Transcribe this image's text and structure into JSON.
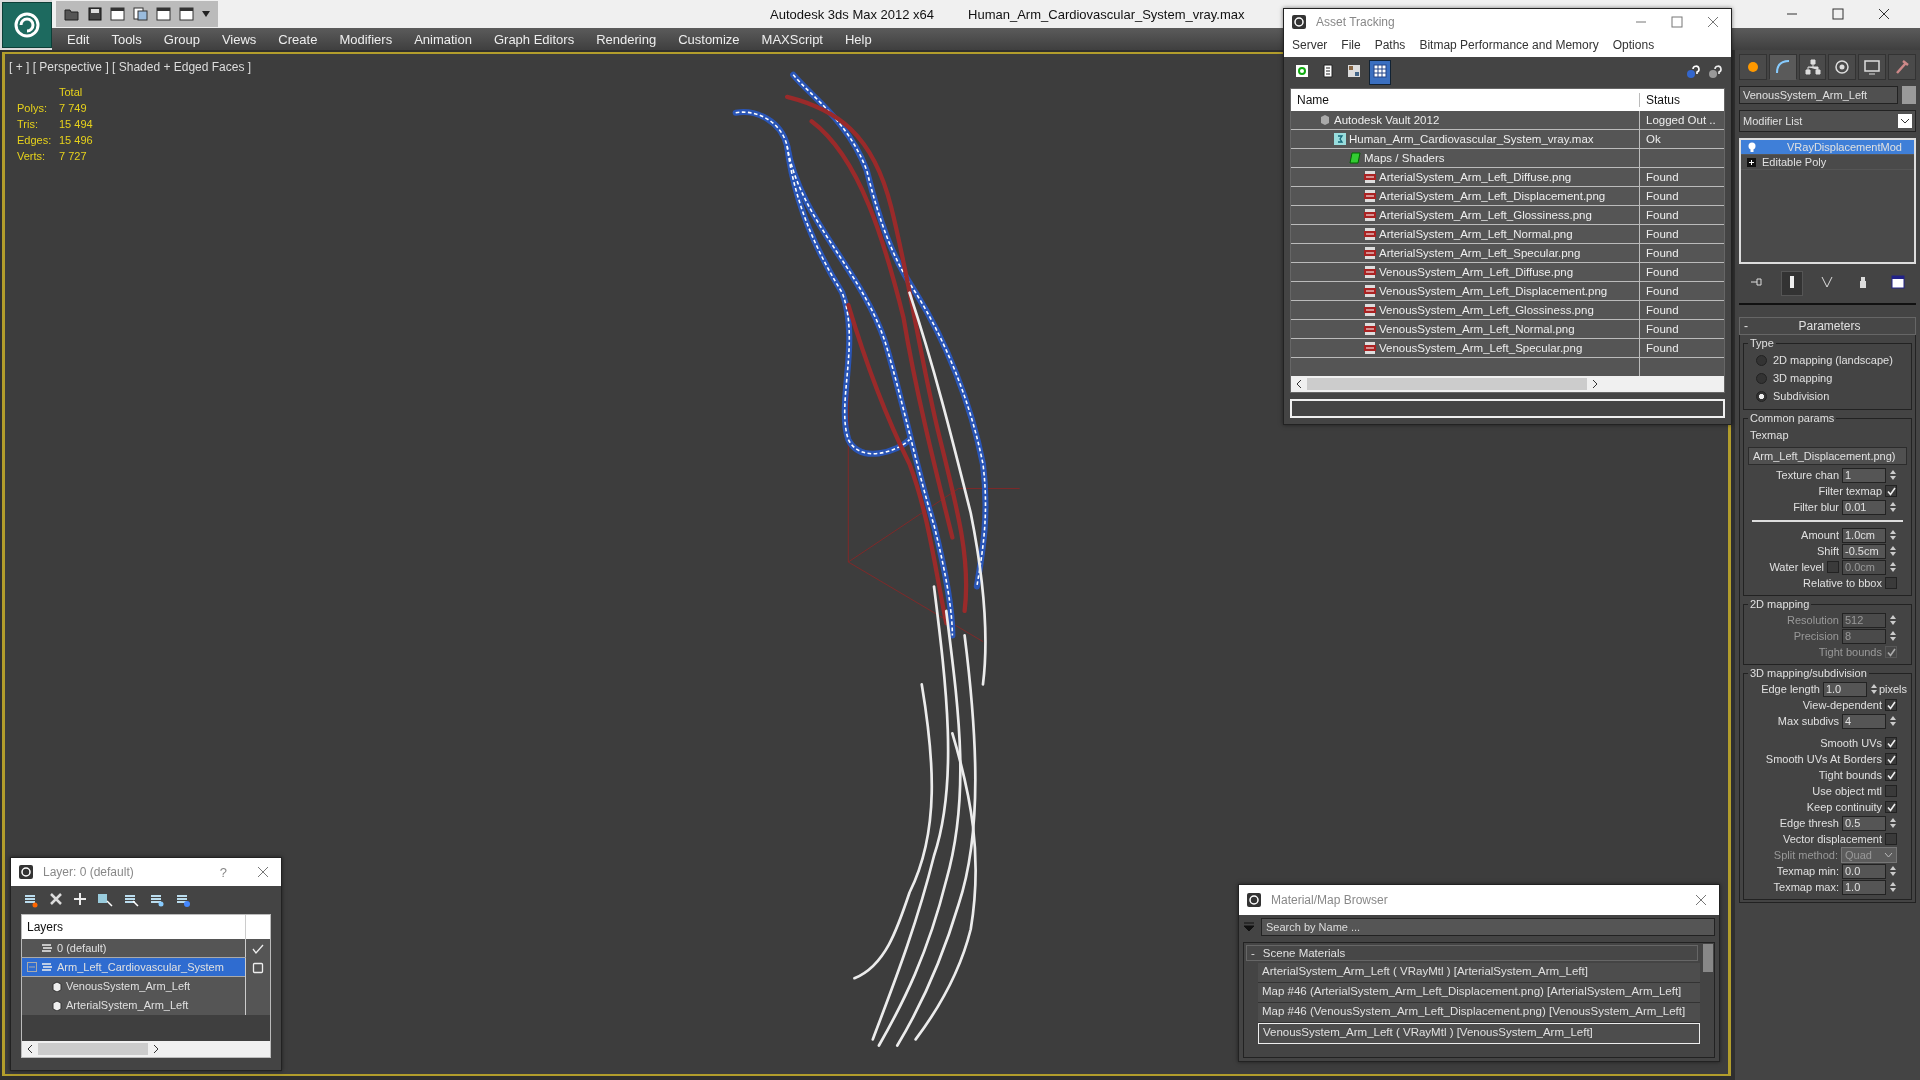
{
  "window": {
    "app_title": "Autodesk 3ds Max  2012 x64",
    "file_title": "Human_Arm_Cardiovascular_System_vray.max"
  },
  "menu": [
    "Edit",
    "Tools",
    "Group",
    "Views",
    "Create",
    "Modifiers",
    "Animation",
    "Graph Editors",
    "Rendering",
    "Customize",
    "MAXScript",
    "Help"
  ],
  "viewport": {
    "label": "[ + ] [ Perspective ] [ Shaded + Edged Faces ]",
    "stats_header": "Total",
    "stats": [
      {
        "label": "Polys:",
        "value": "7 749"
      },
      {
        "label": "Tris:",
        "value": "15 494"
      },
      {
        "label": "Edges:",
        "value": "15 496"
      },
      {
        "label": "Verts:",
        "value": "7 727"
      }
    ]
  },
  "asset_tracking": {
    "title": "Asset Tracking",
    "menu": [
      "Server",
      "File",
      "Paths",
      "Bitmap Performance and Memory",
      "Options"
    ],
    "toolbar": [
      {
        "kind": "refresh",
        "selected": false
      },
      {
        "kind": "list",
        "selected": false
      },
      {
        "kind": "thumbnails",
        "selected": false
      },
      {
        "kind": "table",
        "selected": true
      }
    ],
    "columns": [
      "Name",
      "Status"
    ],
    "tree": [
      {
        "kind": "vault",
        "name": "Autodesk Vault 2012",
        "status": "Logged Out ..",
        "children": [
          {
            "kind": "scene",
            "name": "Human_Arm_Cardiovascular_System_vray.max",
            "status": "Ok",
            "children": [
              {
                "kind": "folder",
                "name": "Maps / Shaders",
                "children": [
                  {
                    "kind": "png",
                    "name": "ArterialSystem_Arm_Left_Diffuse.png",
                    "status": "Found"
                  },
                  {
                    "kind": "png",
                    "name": "ArterialSystem_Arm_Left_Displacement.png",
                    "status": "Found"
                  },
                  {
                    "kind": "png",
                    "name": "ArterialSystem_Arm_Left_Glossiness.png",
                    "status": "Found"
                  },
                  {
                    "kind": "png",
                    "name": "ArterialSystem_Arm_Left_Normal.png",
                    "status": "Found"
                  },
                  {
                    "kind": "png",
                    "name": "ArterialSystem_Arm_Left_Specular.png",
                    "status": "Found"
                  },
                  {
                    "kind": "png",
                    "name": "VenousSystem_Arm_Left_Diffuse.png",
                    "status": "Found"
                  },
                  {
                    "kind": "png",
                    "name": "VenousSystem_Arm_Left_Displacement.png",
                    "status": "Found"
                  },
                  {
                    "kind": "png",
                    "name": "VenousSystem_Arm_Left_Glossiness.png",
                    "status": "Found"
                  },
                  {
                    "kind": "png",
                    "name": "VenousSystem_Arm_Left_Normal.png",
                    "status": "Found"
                  },
                  {
                    "kind": "png",
                    "name": "VenousSystem_Arm_Left_Specular.png",
                    "status": "Found"
                  }
                ]
              }
            ]
          }
        ]
      }
    ]
  },
  "command_panel": {
    "tabs": [
      {
        "kind": "create",
        "selected": false
      },
      {
        "kind": "modify",
        "selected": true
      },
      {
        "kind": "hierarchy",
        "selected": false
      },
      {
        "kind": "motion",
        "selected": false
      },
      {
        "kind": "display",
        "selected": false
      },
      {
        "kind": "utilities",
        "selected": false
      }
    ],
    "object_name": "VenousSystem_Arm_Left",
    "modifier_list": "Modifier List",
    "stack": [
      {
        "kind": "modifier",
        "name": "VRayDisplacementMod",
        "selected": true
      },
      {
        "kind": "base",
        "name": "Editable Poly",
        "selected": false
      }
    ],
    "stack_tools": [
      {
        "kind": "pin",
        "selected": false
      },
      {
        "kind": "end_result",
        "selected": true
      },
      {
        "kind": "unique",
        "selected": false
      },
      {
        "kind": "remove",
        "selected": false
      },
      {
        "kind": "configure",
        "selected": false
      }
    ],
    "rollout": {
      "collapse": "-",
      "title": "Parameters",
      "groups": [
        {
          "title": "Type",
          "rows": [
            {
              "kind": "radio",
              "label": "2D mapping (landscape)",
              "selected": false
            },
            {
              "kind": "radio",
              "label": "3D mapping",
              "selected": false
            },
            {
              "kind": "radio",
              "label": "Subdivision",
              "selected": true
            }
          ]
        },
        {
          "title": "Common params",
          "rows": [
            {
              "kind": "label",
              "label": "Texmap"
            },
            {
              "kind": "map",
              "value": "Arm_Left_Displacement.png)"
            },
            {
              "kind": "spinner",
              "label": "Texture chan",
              "value": "1",
              "disabled": false
            },
            {
              "kind": "check",
              "label": "Filter texmap",
              "checked": true,
              "disabled": false
            },
            {
              "kind": "spinner",
              "label": "Filter blur",
              "value": "0.01",
              "disabled": false
            },
            {
              "kind": "rule"
            },
            {
              "kind": "spinner",
              "label": "Amount",
              "value": "1.0cm",
              "disabled": false
            },
            {
              "kind": "spinner",
              "label": "Shift",
              "value": "-0.5cm",
              "disabled": false
            },
            {
              "kind": "check_spinner",
              "label": "Water level",
              "checked": false,
              "value": "0.0cm",
              "disabled": true
            },
            {
              "kind": "check",
              "label": "Relative to bbox",
              "checked": false,
              "disabled": false
            }
          ]
        },
        {
          "title": "2D mapping",
          "rows": [
            {
              "kind": "spinner",
              "label": "Resolution",
              "value": "512",
              "disabled": true
            },
            {
              "kind": "spinner",
              "label": "Precision",
              "value": "8",
              "disabled": true
            },
            {
              "kind": "check",
              "label": "Tight bounds",
              "checked": true,
              "disabled": true
            }
          ]
        },
        {
          "title": "3D mapping/subdivision",
          "rows": [
            {
              "kind": "spinner",
              "label": "Edge length",
              "value": "1.0",
              "unit": "pixels",
              "disabled": false
            },
            {
              "kind": "check",
              "label": "View-dependent",
              "checked": true,
              "disabled": false
            },
            {
              "kind": "spinner",
              "label": "Max subdivs",
              "value": "4",
              "disabled": false
            },
            {
              "kind": "gap"
            },
            {
              "kind": "check",
              "label": "Smooth UVs",
              "checked": true,
              "disabled": false
            },
            {
              "kind": "check",
              "label": "Smooth UVs At Borders",
              "checked": true,
              "disabled": false
            },
            {
              "kind": "check",
              "label": "Tight bounds",
              "checked": true,
              "disabled": false
            },
            {
              "kind": "check",
              "label": "Use object mtl",
              "checked": false,
              "disabled": false
            },
            {
              "kind": "check",
              "label": "Keep continuity",
              "checked": true,
              "disabled": false
            },
            {
              "kind": "spinner",
              "label": "Edge thresh",
              "value": "0.5",
              "disabled": false
            },
            {
              "kind": "check",
              "label": "Vector displacement",
              "checked": false,
              "disabled": false
            },
            {
              "kind": "dropdown",
              "label": "Split method:",
              "value": "Quad",
              "disabled": true
            },
            {
              "kind": "spinner",
              "label": "Texmap min:",
              "value": "0.0",
              "disabled": false
            },
            {
              "kind": "spinner",
              "label": "Texmap max:",
              "value": "1.0",
              "disabled": false
            }
          ]
        }
      ]
    }
  },
  "layer_window": {
    "title": "Layer: 0 (default)",
    "help": "?",
    "column": "Layers",
    "tree": [
      {
        "kind": "layer",
        "name": "0 (default)",
        "current": true,
        "selected": false
      },
      {
        "kind": "layer",
        "name": "Arm_Left_Cardiovascular_System",
        "current": false,
        "selected": true,
        "expanded": true,
        "children": [
          {
            "kind": "object",
            "name": "VenousSystem_Arm_Left",
            "selected": false
          },
          {
            "kind": "object",
            "name": "ArterialSystem_Arm_Left",
            "selected": false
          }
        ]
      }
    ]
  },
  "material_browser": {
    "title": "Material/Map Browser",
    "search_placeholder": "Search by Name ...",
    "group_toggle": "-",
    "group": "Scene Materials",
    "items": [
      {
        "label": "ArterialSystem_Arm_Left  ( VRayMtl )  [ArterialSystem_Arm_Left]",
        "selected": false
      },
      {
        "label": "Map #46 (ArterialSystem_Arm_Left_Displacement.png)  [ArterialSystem_Arm_Left]",
        "selected": false
      },
      {
        "label": "Map #46 (VenousSystem_Arm_Left_Displacement.png)  [VenousSystem_Arm_Left]",
        "selected": false
      },
      {
        "label": "VenousSystem_Arm_Left  ( VRayMtl )  [VenousSystem_Arm_Left]",
        "selected": true
      }
    ]
  }
}
